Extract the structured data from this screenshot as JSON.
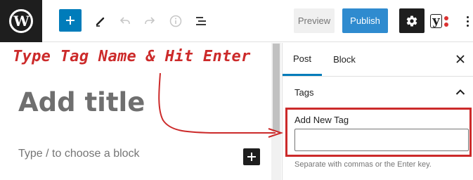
{
  "toolbar": {
    "logo_icon": "wordpress-icon",
    "icons": [
      "plus-icon",
      "pencil-icon",
      "undo-icon",
      "redo-icon",
      "info-icon",
      "list-view-icon",
      "gear-icon",
      "yoast-icon",
      "more-vertical-icon"
    ],
    "preview_label": "Preview",
    "publish_label": "Publish",
    "accent_color": "#007cba"
  },
  "annotation": {
    "text": "Type Tag Name & Hit Enter",
    "color": "#cc2a2a"
  },
  "editor": {
    "title_placeholder": "Add title",
    "block_hint": "Type / to choose a block"
  },
  "sidebar": {
    "tabs": [
      {
        "label": "Post",
        "active": true
      },
      {
        "label": "Block",
        "active": false
      }
    ],
    "panel_title": "Tags",
    "tag_field_label": "Add New Tag",
    "tag_field_value": "",
    "help_text": "Separate with commas or the Enter key."
  }
}
